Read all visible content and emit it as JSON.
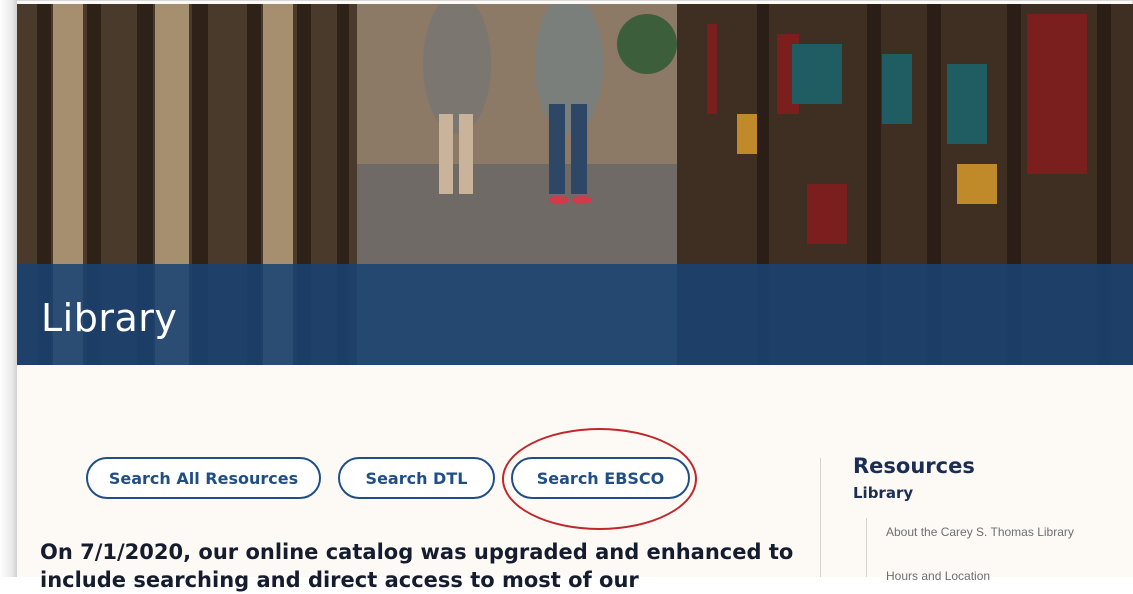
{
  "hero": {
    "title": "Library"
  },
  "search_buttons": {
    "all_resources": "Search All Resources",
    "dtl": "Search DTL",
    "ebsco": "Search EBSCO"
  },
  "notice": {
    "text": "On 7/1/2020, our online catalog was upgraded and enhanced to include searching and direct access to most of our"
  },
  "sidebar": {
    "heading": "Resources",
    "subheading": "Library",
    "links": [
      {
        "label": "About the Carey S. Thomas Library"
      },
      {
        "label": "Hours and Location"
      }
    ]
  },
  "colors": {
    "banner_blue": "#194273",
    "button_blue": "#1f4f86",
    "annotation_red": "#c0262a",
    "page_background": "#fdf9f5"
  }
}
